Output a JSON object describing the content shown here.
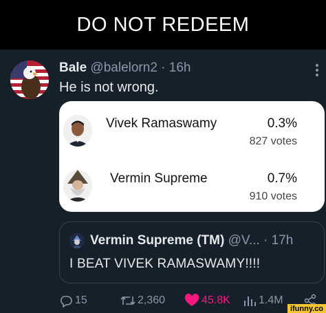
{
  "meme": {
    "title": "DO NOT REDEEM"
  },
  "tweet": {
    "display_name": "Bale",
    "handle": "@balelorn2",
    "separator": "·",
    "time": "16h",
    "text": "He is not wrong.",
    "avatar_icon": "eagle-flag-icon"
  },
  "poll": {
    "options": [
      {
        "label": "Vivek Ramaswamy",
        "percent": "0.3%",
        "votes": "827 votes"
      },
      {
        "label": "Vermin Supreme",
        "percent": "0.7%",
        "votes": "910 votes"
      }
    ]
  },
  "quote": {
    "display_name": "Vermin Supreme (TM)",
    "handle": "@V...",
    "separator": "·",
    "time": "17h",
    "text": "I BEAT VIVEK RAMASWAMY!!!!"
  },
  "actions": {
    "replies": "15",
    "retweets": "2,360",
    "likes": "45.8K",
    "views": "1.4M"
  },
  "colors": {
    "background": "#15202b",
    "like": "#f91880",
    "muted": "#8b98a5"
  },
  "watermark": "ifunny.co"
}
